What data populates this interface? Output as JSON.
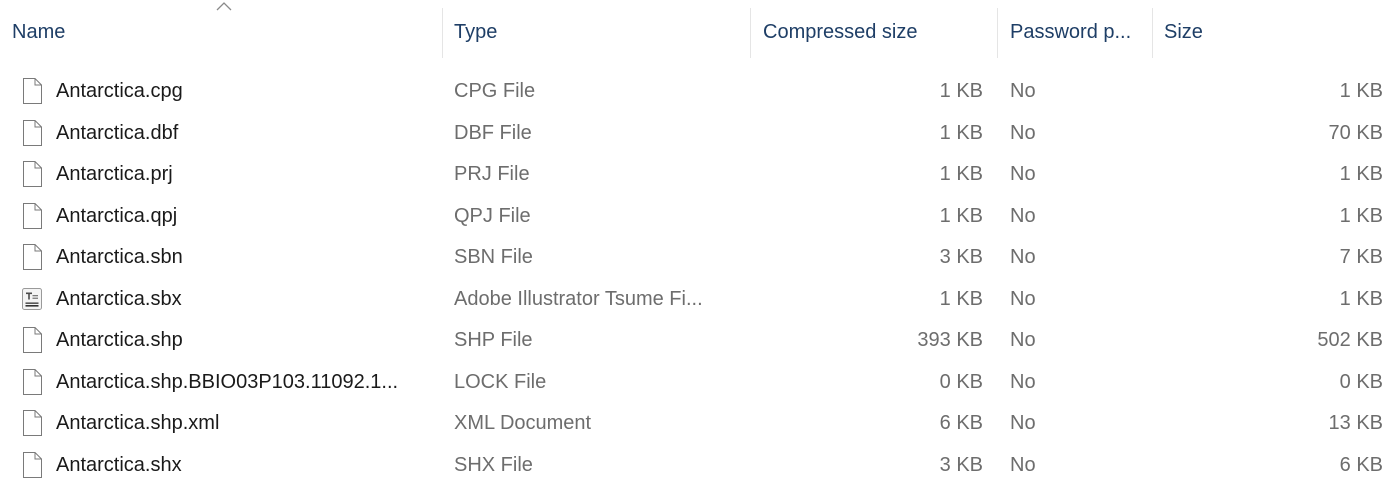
{
  "columns": {
    "name": "Name",
    "type": "Type",
    "compressed_size": "Compressed size",
    "password": "Password p...",
    "size": "Size"
  },
  "sort": {
    "column": "name",
    "direction": "ascending"
  },
  "files": [
    {
      "name": "Antarctica.cpg",
      "type": "CPG File",
      "compressed": "1 KB",
      "password": "No",
      "size": "1 KB",
      "icon": "generic-file-icon"
    },
    {
      "name": "Antarctica.dbf",
      "type": "DBF File",
      "compressed": "1 KB",
      "password": "No",
      "size": "70 KB",
      "icon": "generic-file-icon"
    },
    {
      "name": "Antarctica.prj",
      "type": "PRJ File",
      "compressed": "1 KB",
      "password": "No",
      "size": "1 KB",
      "icon": "generic-file-icon"
    },
    {
      "name": "Antarctica.qpj",
      "type": "QPJ File",
      "compressed": "1 KB",
      "password": "No",
      "size": "1 KB",
      "icon": "generic-file-icon"
    },
    {
      "name": "Antarctica.sbn",
      "type": "SBN File",
      "compressed": "3 KB",
      "password": "No",
      "size": "7 KB",
      "icon": "generic-file-icon"
    },
    {
      "name": "Antarctica.sbx",
      "type": "Adobe Illustrator Tsume Fi...",
      "compressed": "1 KB",
      "password": "No",
      "size": "1 KB",
      "icon": "tsume-file-icon"
    },
    {
      "name": "Antarctica.shp",
      "type": "SHP File",
      "compressed": "393 KB",
      "password": "No",
      "size": "502 KB",
      "icon": "generic-file-icon"
    },
    {
      "name": "Antarctica.shp.BBIO03P103.11092.1...",
      "type": "LOCK File",
      "compressed": "0 KB",
      "password": "No",
      "size": "0 KB",
      "icon": "generic-file-icon"
    },
    {
      "name": "Antarctica.shp.xml",
      "type": "XML Document",
      "compressed": "6 KB",
      "password": "No",
      "size": "13 KB",
      "icon": "generic-file-icon"
    },
    {
      "name": "Antarctica.shx",
      "type": "SHX File",
      "compressed": "3 KB",
      "password": "No",
      "size": "6 KB",
      "icon": "generic-file-icon"
    }
  ]
}
